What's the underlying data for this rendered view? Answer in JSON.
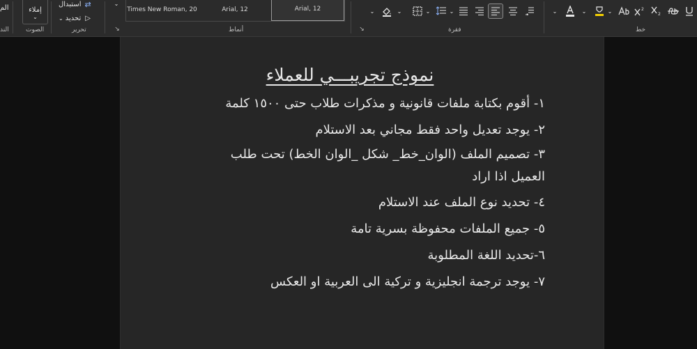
{
  "ribbon": {
    "voice": {
      "dictate_label": "إملاء",
      "group_label": "الصوت"
    },
    "editing": {
      "replace_label": "استبدال",
      "select_label": "تحديد",
      "group_label": "تحرير"
    },
    "partial_left_label_top": "الم",
    "partial_left_label_bottom": "الند",
    "styles": {
      "group_label": "أنماط",
      "items": [
        {
          "label": "Times New Roman, 20"
        },
        {
          "label": "Arial, 12"
        },
        {
          "label": "Arial, 12"
        }
      ]
    },
    "paragraph": {
      "group_label": "فقرة"
    },
    "font": {
      "group_label": "خط"
    }
  },
  "document": {
    "title": "نموذج تجريبـــي للعملاء",
    "lines": [
      "١- أقوم بكتابة ملفات قانونية و مذكرات طلاب حتى ١٥٠٠ كلمة",
      "٢- يوجد تعديل واحد فقط مجاني بعد الاستلام",
      "٣- تصميم الملف (الوان_خط_ شكل _الوان الخط) تحت طلب العميل اذا اراد",
      "٤- تحديد نوع الملف عند الاستلام",
      "٥- جميع الملفات محفوظة بسرية تامة",
      "٦-تحديد اللغة المطلوبة",
      "٧- يوجد ترجمة انجليزية و تركية الى العربية او العكس"
    ]
  },
  "colors": {
    "ribbon_bg": "#2b2b2b",
    "page_bg": "#262626",
    "workspace_bg": "#101010",
    "text": "#e8e8e8"
  }
}
